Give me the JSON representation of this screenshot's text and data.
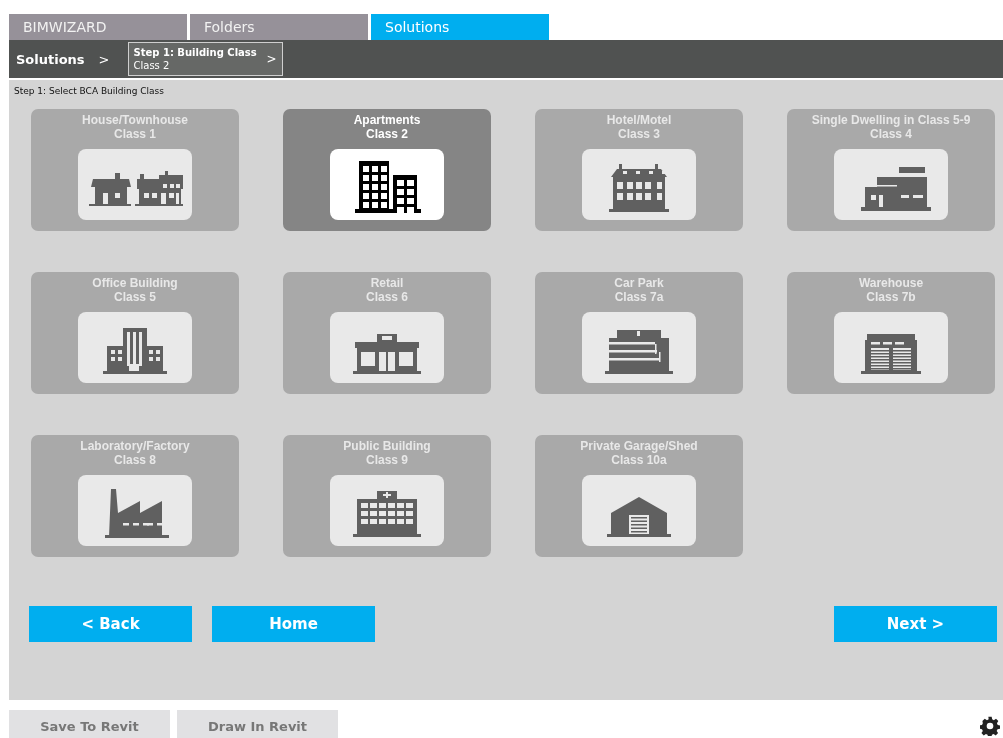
{
  "tabs": [
    {
      "label": "BIMWIZARD",
      "selected": false
    },
    {
      "label": "Folders",
      "selected": false
    },
    {
      "label": "Solutions",
      "selected": true
    }
  ],
  "breadcrumb": {
    "root": "Solutions",
    "root_arrow": ">",
    "step_title": "Step 1: Building Class",
    "step_value": "Class 2",
    "step_arrow": ">"
  },
  "instruction": "Step 1: Select BCA Building Class",
  "classes": [
    {
      "name": "House/Townhouse",
      "class": "Class 1",
      "selected": false
    },
    {
      "name": "Apartments",
      "class": "Class 2",
      "selected": true
    },
    {
      "name": "Hotel/Motel",
      "class": "Class 3",
      "selected": false
    },
    {
      "name": "Single Dwelling in Class 5-9",
      "class": "Class 4",
      "selected": false
    },
    {
      "name": "Office Building",
      "class": "Class 5",
      "selected": false
    },
    {
      "name": "Retail",
      "class": "Class 6",
      "selected": false
    },
    {
      "name": "Car Park",
      "class": "Class 7a",
      "selected": false
    },
    {
      "name": "Warehouse",
      "class": "Class 7b",
      "selected": false
    },
    {
      "name": "Laboratory/Factory",
      "class": "Class 8",
      "selected": false
    },
    {
      "name": "Public Building",
      "class": "Class 9",
      "selected": false
    },
    {
      "name": "Private Garage/Shed",
      "class": "Class 10a",
      "selected": false
    }
  ],
  "nav_buttons": {
    "back": "< Back",
    "home": "Home",
    "next": "Next >"
  },
  "revit_buttons": [
    "Save To Revit",
    "Draw In Revit"
  ]
}
